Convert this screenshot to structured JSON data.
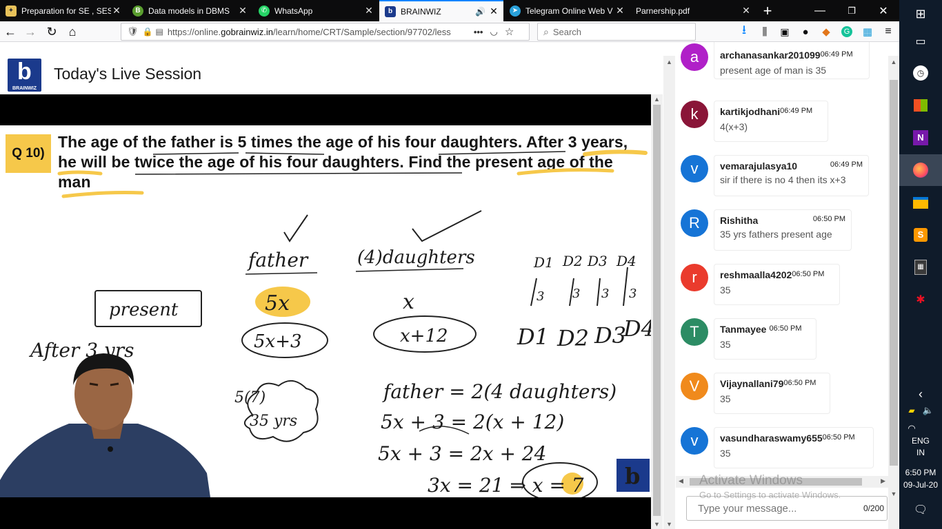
{
  "browser": {
    "tabs": [
      {
        "title": "Preparation for SE , SES",
        "icon": "lightbulb-icon",
        "color": "#e8c25a",
        "glyph": "💡"
      },
      {
        "title": "Data models in DBMS",
        "icon": "b-logo-icon",
        "color": "#5a9e2f",
        "glyph": "B"
      },
      {
        "title": "WhatsApp",
        "icon": "whatsapp-icon",
        "color": "#25d366",
        "glyph": "✆"
      },
      {
        "title": "BRAINWIZ",
        "icon": "brainwiz-icon",
        "color": "#1b3a8c",
        "glyph": "b",
        "active": true
      },
      {
        "title": "Telegram Online Web V",
        "icon": "telegram-icon",
        "color": "#2aa1da",
        "glyph": "➤"
      },
      {
        "title": "Parnership.pdf",
        "icon": "",
        "color": "",
        "glyph": ""
      }
    ],
    "url_prefix": "https://online.",
    "url_host": "gobrainwiz.in",
    "url_path": "/learn/home/CRT/Sample/section/97702/less",
    "search_placeholder": "Search"
  },
  "page": {
    "title": "Today's Live Session",
    "logo_text": "BRAINWIZ"
  },
  "question": {
    "label": "Q 10)",
    "text": "The age of the father is 5 times the age of his four daughters. After 3 years, he will be twice the age of his four daughters. Find the present age of the man"
  },
  "board": {
    "father": "father",
    "daughters": "(4)daughters",
    "present": "present",
    "after": "After 3 yrs",
    "fivex": "5x",
    "x": "x",
    "fivexplus3": "5x+3",
    "xplus12": "x+12",
    "d_labels": [
      "D1",
      "D2",
      "D3",
      "D4"
    ],
    "d3": [
      "3",
      "3",
      "3",
      "3"
    ],
    "eq1": "father = 2(4 daughters)",
    "eq2": "5x + 3 = 2(x + 12)",
    "eq3": "5x + 3 = 2x + 24",
    "eq4": "3x = 21 ⇒ x = 7",
    "cloud": "5(7)",
    "cloud2": "35 yrs"
  },
  "chat": {
    "messages": [
      {
        "initial": "a",
        "color": "#b020c8",
        "name": "archanasankar201099",
        "time": "06:49 PM",
        "text": "present age of man is 35"
      },
      {
        "initial": "k",
        "color": "#8a1538",
        "name": "kartikjodhani",
        "time": "06:49 PM",
        "text": "4(x+3)"
      },
      {
        "initial": "v",
        "color": "#1674d6",
        "name": "vemarajulasya10",
        "time": "06:49 PM",
        "text": "sir if there is no 4 then its x+3"
      },
      {
        "initial": "R",
        "color": "#1674d6",
        "name": "Rishitha",
        "time": "06:50 PM",
        "text": "35 yrs fathers present age"
      },
      {
        "initial": "r",
        "color": "#ea3b2d",
        "name": "reshmaalla4202",
        "time": "06:50 PM",
        "text": "35"
      },
      {
        "initial": "T",
        "color": "#2c8c64",
        "name": "Tanmayee",
        "time": "06:50 PM",
        "text": "35"
      },
      {
        "initial": "V",
        "color": "#f08a1c",
        "name": "Vijaynallani79",
        "time": "06:50 PM",
        "text": "35"
      },
      {
        "initial": "v",
        "color": "#1674d6",
        "name": "vasundharaswamy655",
        "time": "06:50 PM",
        "text": "35"
      }
    ],
    "input_placeholder": "Type your message...",
    "counter": "0/200",
    "watermark_title": "Activate Windows",
    "watermark_sub": "Go to Settings to activate Windows."
  },
  "taskbar": {
    "lang": "ENG",
    "region": "IN",
    "time": "6:50 PM",
    "date": "09-Jul-20"
  }
}
